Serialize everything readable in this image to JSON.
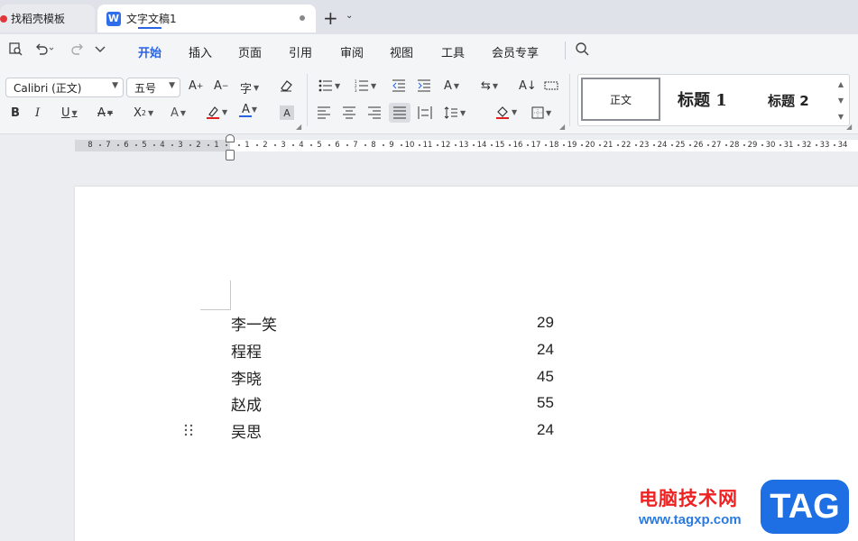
{
  "tabs": {
    "templates": "找稻壳模板",
    "doc_logo": "W",
    "doc": "文字文稿1",
    "new_tab": "+",
    "more": "⌄"
  },
  "menu": {
    "items": [
      "开始",
      "插入",
      "页面",
      "引用",
      "审阅",
      "视图",
      "工具",
      "会员专享"
    ]
  },
  "ribbon": {
    "font_family": "Calibri (正文)",
    "font_size": "五号",
    "styles": {
      "normal": "正文",
      "heading1": "标题 1",
      "heading2": "标题 2"
    }
  },
  "ruler": {
    "left_ticks": [
      "8",
      "7",
      "6",
      "5",
      "4",
      "3",
      "2",
      "1"
    ],
    "right_ticks": [
      "1",
      "2",
      "3",
      "4",
      "5",
      "6",
      "7",
      "8",
      "9",
      "10",
      "11",
      "12",
      "13",
      "14",
      "15",
      "16",
      "17",
      "18",
      "19",
      "20",
      "21",
      "22",
      "23",
      "24",
      "25",
      "26",
      "27",
      "28",
      "29",
      "30",
      "31",
      "32",
      "33",
      "34"
    ]
  },
  "document": {
    "rows": [
      {
        "name": "李一笑",
        "value": "29"
      },
      {
        "name": "程程",
        "value": "24"
      },
      {
        "name": "李晓",
        "value": "45"
      },
      {
        "name": "赵成",
        "value": "55"
      },
      {
        "name": "吴思",
        "value": "24"
      }
    ]
  },
  "watermark": {
    "text": "电脑技术网",
    "url": "www.tagxp.com",
    "badge": "TAG"
  },
  "colors": {
    "accent": "#2b64e0",
    "font_color_underline": "#2b64e0",
    "highlight_underline": "#e02020"
  }
}
